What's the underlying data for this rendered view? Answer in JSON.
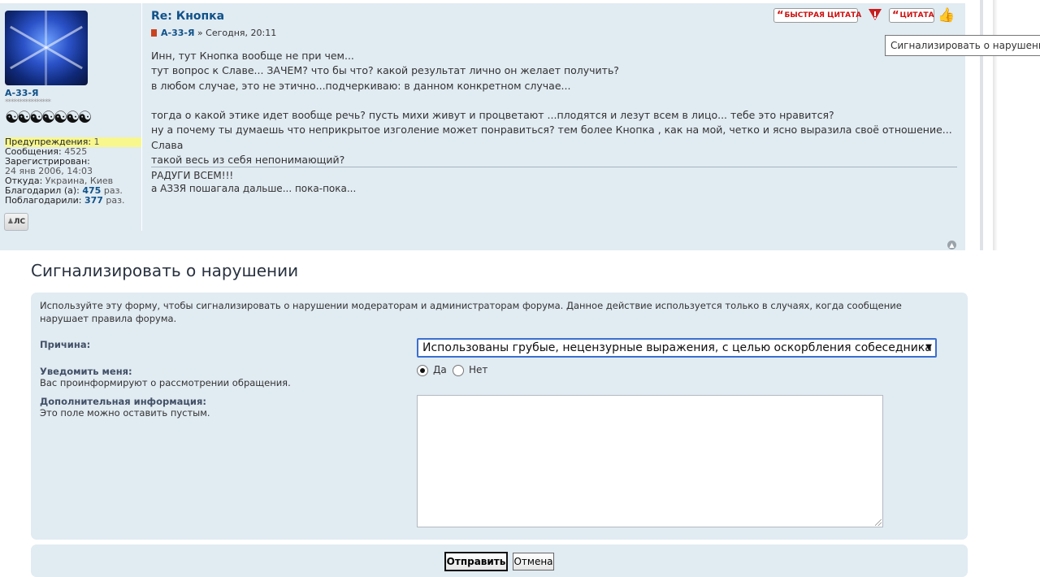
{
  "post": {
    "title": "Re: Кнопка",
    "author": "А-33-Я",
    "meta_sep": "»",
    "time": "Сегодня, 20:11",
    "lines": [
      "Инн, тут Кнопка вообще не при чем...",
      "тут вопрос к Славе... ЗАЧЕМ? что бы что? какой результат лично он желает получить?",
      "в любом случае, это не этично...подчеркиваю: в данном конкретном случае...",
      "",
      "тогда о какой этике идет вообще речь? пусть михи живут и процветают ...плодятся и лезут всем в лицо... тебе это нравится?",
      "ну а почему ты думаешь что неприкрытое изголение может понравиться? тем более Кнопка , как на мой, четко и ясно выразила своё отношение... Слава",
      "такой весь из себя непонимающий?"
    ],
    "signature_line1": "РАДУГИ ВСЕМ!!!",
    "signature_line2": "а АЗЗЯ пошагала дальше... пока-пока...",
    "buttons": {
      "quick_quote": "БЫСТРАЯ ЦИТАТА",
      "quote": "ЦИТАТА",
      "quote_mark": "“"
    },
    "tooltip": "Сигнализировать о нарушении"
  },
  "profile": {
    "username": "А-33-Я",
    "rank_stars": "****************",
    "rank_symbols": "☯☯☯☯☯☯☯",
    "warnings_label": "Предупреждения:",
    "warnings_value": "1",
    "posts_label": "Сообщения:",
    "posts_value": "4525",
    "registered_label": "Зарегистрирован:",
    "registered_value": "24 янв 2006, 14:03",
    "from_label": "Откуда:",
    "from_value": "Украина, Киев",
    "thanked_label": "Благодарил (а):",
    "thanked_value": "475",
    "thanked_unit": "раз.",
    "was_thanked_label": "Поблагодарили:",
    "was_thanked_value": "377",
    "was_thanked_unit": "раз.",
    "pm_label": "ЛС"
  },
  "report": {
    "title": "Сигнализировать о нарушении",
    "description": "Используйте эту форму, чтобы сигнализировать о нарушении модераторам и администраторам форума. Данное действие используется только в случаях, когда сообщение нарушает правила форума.",
    "reason_label": "Причина:",
    "reason_selected": "Использованы грубые, нецензурные выражения, с целью оскорбления собеседника",
    "notify_label": "Уведомить меня:",
    "notify_sub": "Вас проинформируют о рассмотрении обращения.",
    "notify_yes": "Да",
    "notify_no": "Нет",
    "info_label": "Дополнительная информация:",
    "info_sub": "Это поле можно оставить пустым.",
    "info_value": "",
    "submit": "Отправить",
    "cancel": "Отмена"
  }
}
